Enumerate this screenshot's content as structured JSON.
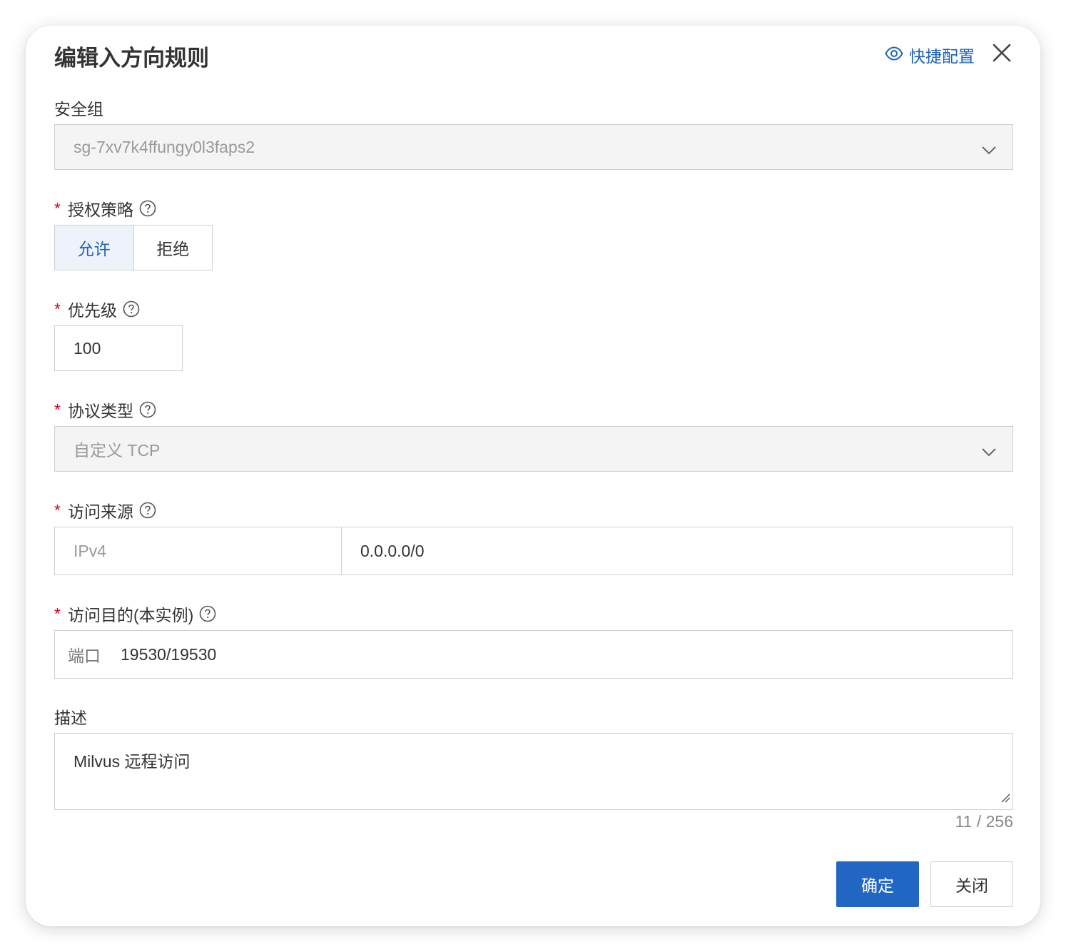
{
  "dialog": {
    "title": "编辑入方向规则",
    "quick_config": "快捷配置"
  },
  "security_group": {
    "label": "安全组",
    "value": "sg-7xv7k4ffungy0l3faps2"
  },
  "auth_policy": {
    "label": "授权策略",
    "options": [
      "允许",
      "拒绝"
    ],
    "selected": "允许"
  },
  "priority": {
    "label": "优先级",
    "value": "100"
  },
  "protocol": {
    "label": "协议类型",
    "value": "自定义 TCP"
  },
  "source": {
    "label": "访问来源",
    "type": "IPv4",
    "value": "0.0.0.0/0"
  },
  "destination": {
    "label": "访问目的(本实例)",
    "prefix": "端口",
    "value": "19530/19530"
  },
  "description": {
    "label": "描述",
    "value": "Milvus 远程访问",
    "counter": "11 / 256"
  },
  "footer": {
    "confirm": "确定",
    "close": "关闭"
  },
  "colors": {
    "primary": "#2266c4",
    "link": "#1f63b7",
    "required": "#d0021b"
  }
}
